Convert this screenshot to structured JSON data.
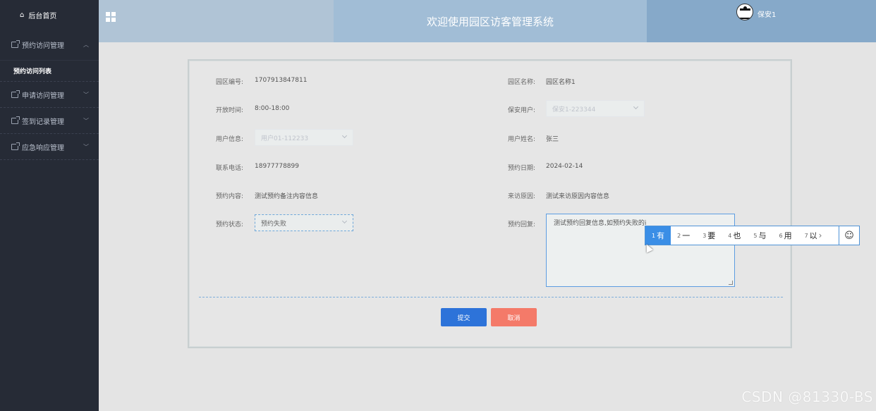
{
  "sidebar": {
    "home": "后台首页",
    "groups": [
      {
        "label": "预约访问管理"
      },
      {
        "label": "申请访问管理"
      },
      {
        "label": "签到记录管理"
      },
      {
        "label": "应急响应管理"
      }
    ],
    "active_sub": "预约访问列表"
  },
  "header": {
    "title": "欢迎使用园区访客管理系统",
    "username": "保安1"
  },
  "form": {
    "park_no_label": "园区编号:",
    "park_no": "1707913847811",
    "park_name_label": "园区名称:",
    "park_name": "园区名称1",
    "open_time_label": "开放时间:",
    "open_time": "8:00-18:00",
    "guard_label": "保安用户:",
    "guard_value": "保安1-223344",
    "user_info_label": "用户信息:",
    "user_info_value": "用户01-112233",
    "user_name_label": "用户姓名:",
    "user_name": "张三",
    "phone_label": "联系电话:",
    "phone": "18977778899",
    "date_label": "预约日期:",
    "date": "2024-02-14",
    "content_label": "预约内容:",
    "content": "测试预约备注内容信息",
    "reason_label": "来访原因:",
    "reason": "测试来访原因内容信息",
    "status_label": "预约状态:",
    "status_value": "预约失败",
    "reply_label": "预约回复:",
    "reply_value": "测试预约回复信息,如预约失败的i",
    "submit": "提交",
    "cancel": "取消"
  },
  "ime": {
    "candidates": [
      {
        "n": "1",
        "c": "有"
      },
      {
        "n": "2",
        "c": "一"
      },
      {
        "n": "3",
        "c": "要"
      },
      {
        "n": "4",
        "c": "也"
      },
      {
        "n": "5",
        "c": "与"
      },
      {
        "n": "6",
        "c": "用"
      },
      {
        "n": "7",
        "c": "以"
      }
    ],
    "emoji": "☺"
  },
  "watermark": "CSDN @81330-BS"
}
